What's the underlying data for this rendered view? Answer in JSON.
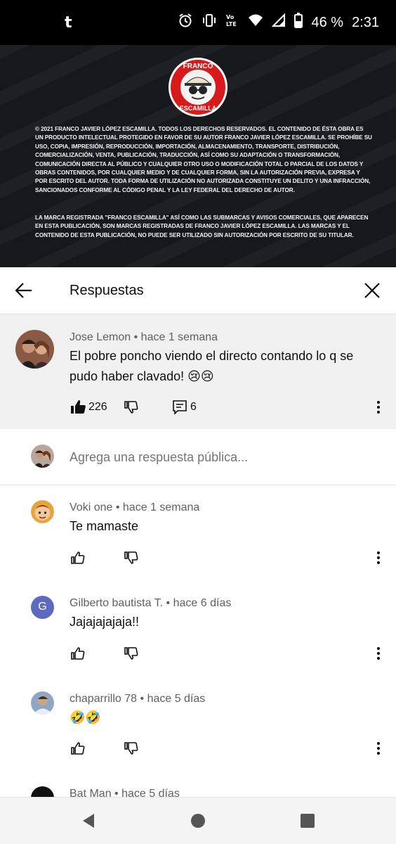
{
  "status_bar": {
    "left_icon": "tumblr-t-icon",
    "battery": "46 %",
    "time": "2:31",
    "volte": "Vo LTE"
  },
  "video": {
    "logo_top": "FRANCO",
    "logo_bottom": "ESCAMILLA",
    "legal_paragraph_1": "© 2021 Franco Javier López Escamilla. Todos los derechos reservados. El contenido de ésta obra es un producto intelectual protegido en favor de su autor Franco Javier López Escamilla. Se prohíbe su uso, copia, impresión, reproducción, importación, almacenamiento, transporte, distribución, comercialización, venta, publicación, traducción, así como su adaptación o transformación, comunicación directa al público y cualquier otro uso o modificación total o parcial de los datos y obras contenidos, por cualquier medio y de cualquier forma, sin la autorización previa, expresa y por escrito del autor. Toda forma de utilización no autorizada constituye un delito y una infracción, sancionados conforme al código penal y la ley federal del derecho de autor.",
    "legal_paragraph_2": "La marca registrada \"Franco Escamilla\" así como las submarcas y avisos comerciales, que aparecen en esta publicación, son marcas registradas de Franco Javier López Escamilla. Las marcas y el contenido de esta publicación, no puede ser utilizado sin autorización por escrito de su titular.",
    "progress_fraction": 0.01
  },
  "panel": {
    "title": "Respuestas"
  },
  "parent_comment": {
    "author": "Jose Lemon",
    "time": "hace 1 semana",
    "text_line_1": "El pobre poncho viendo el directo contando lo q se",
    "text_line_2": "pudo haber clavado! 😢😢",
    "likes": "226",
    "replies": "6"
  },
  "reply_box": {
    "placeholder": "Agrega una respuesta pública..."
  },
  "replies": [
    {
      "author": "Voki one",
      "time": "hace 1 semana",
      "text": "Te mamaste"
    },
    {
      "author": "Gilberto bautista T.",
      "time": "hace 6 días",
      "text": "Jajajajajaja!!",
      "avatar_letter": "G"
    },
    {
      "author": "chaparrillo 78",
      "time": "hace 5 días",
      "text": "🤣🤣"
    },
    {
      "author": "Bat Man",
      "time": "hace 5 días",
      "text": ""
    }
  ],
  "separator": " • ",
  "colors": {
    "parent_bg": "#f0f0f0",
    "meta_text": "#606060",
    "logo_red": "#d81a1a",
    "letter_avatar": "#5c6bc0"
  }
}
